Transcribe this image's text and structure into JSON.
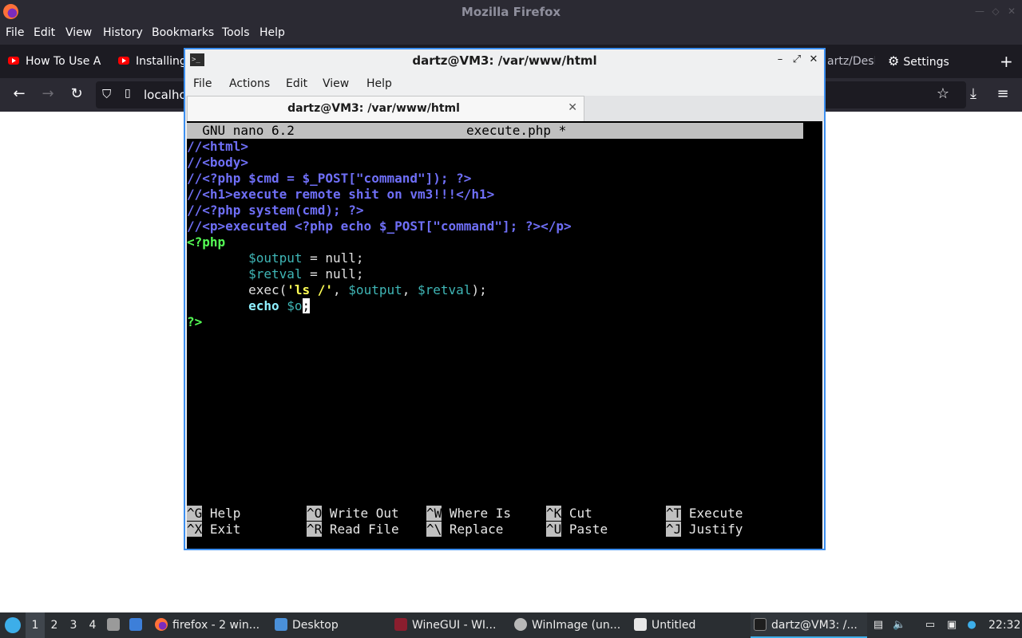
{
  "firefox": {
    "window_title": "Mozilla Firefox",
    "menu": [
      "File",
      "Edit",
      "View",
      "History",
      "Bookmarks",
      "Tools",
      "Help"
    ],
    "tabs": [
      {
        "label": "How To Use A",
        "icon": "youtube-icon"
      },
      {
        "label": "Installing",
        "icon": "youtube-icon"
      },
      {
        "label": "artz/Desk",
        "icon": ""
      },
      {
        "label": "Settings",
        "icon": "gear-icon"
      }
    ],
    "url": "localho",
    "colors": {
      "chrome": "#2b2a33",
      "tabbar": "#1c1b22"
    }
  },
  "terminal": {
    "window_title": "dartz@VM3: /var/www/html",
    "tab_title": "dartz@VM3: /var/www/html",
    "menu": [
      "File",
      "Actions",
      "Edit",
      "View",
      "Help"
    ],
    "accent": "#3c8ff0"
  },
  "nano": {
    "header_left": "  GNU nano 6.2",
    "header_file": "execute.php *",
    "lines": [
      {
        "parts": [
          {
            "t": "//<html>",
            "c": "cm"
          }
        ]
      },
      {
        "parts": [
          {
            "t": "//<body>",
            "c": "cm"
          }
        ]
      },
      {
        "parts": [
          {
            "t": "//<?php $cmd = $_POST[\"command\"]); ?>",
            "c": "cm"
          }
        ]
      },
      {
        "parts": [
          {
            "t": "//<h1>execute remote shit on vm3!!!</h1>",
            "c": "cm"
          }
        ]
      },
      {
        "parts": [
          {
            "t": "//<?php system(cmd); ?>",
            "c": "cm"
          }
        ]
      },
      {
        "parts": [
          {
            "t": "//<p>executed <?php echo $_POST[\"command\"]; ?></p>",
            "c": "cm"
          }
        ]
      },
      {
        "parts": [
          {
            "t": "<?php",
            "c": "kw"
          }
        ]
      },
      {
        "parts": [
          {
            "t": "        ",
            "c": "pl"
          },
          {
            "t": "$output",
            "c": "var"
          },
          {
            "t": " = null;",
            "c": "pl"
          }
        ]
      },
      {
        "parts": [
          {
            "t": "        ",
            "c": "pl"
          },
          {
            "t": "$retval",
            "c": "var"
          },
          {
            "t": " = null;",
            "c": "pl"
          }
        ]
      },
      {
        "parts": [
          {
            "t": "        exec(",
            "c": "pl"
          },
          {
            "t": "'ls /'",
            "c": "str"
          },
          {
            "t": ", ",
            "c": "pl"
          },
          {
            "t": "$output",
            "c": "var"
          },
          {
            "t": ", ",
            "c": "pl"
          },
          {
            "t": "$retval",
            "c": "var"
          },
          {
            "t": ");",
            "c": "pl"
          }
        ]
      },
      {
        "parts": [
          {
            "t": "        ",
            "c": "pl"
          },
          {
            "t": "echo",
            "c": "ec"
          },
          {
            "t": " ",
            "c": "pl"
          },
          {
            "t": "$o",
            "c": "var"
          },
          {
            "t": ";",
            "c": "cursor"
          }
        ]
      },
      {
        "parts": [
          {
            "t": "?>",
            "c": "kw"
          }
        ]
      }
    ],
    "shortcuts": [
      [
        {
          "key": "^G",
          "label": "Help"
        },
        {
          "key": "^O",
          "label": "Write Out"
        },
        {
          "key": "^W",
          "label": "Where Is"
        },
        {
          "key": "^K",
          "label": "Cut"
        },
        {
          "key": "^T",
          "label": "Execute"
        }
      ],
      [
        {
          "key": "^X",
          "label": "Exit"
        },
        {
          "key": "^R",
          "label": "Read File"
        },
        {
          "key": "^\\",
          "label": "Replace"
        },
        {
          "key": "^U",
          "label": "Paste"
        },
        {
          "key": "^J",
          "label": "Justify"
        }
      ]
    ]
  },
  "taskbar": {
    "workspaces": [
      "1",
      "2",
      "3",
      "4"
    ],
    "tasks": [
      {
        "label": "firefox - 2 win...",
        "icon": "firefox-icon"
      },
      {
        "label": "Desktop",
        "icon": "folder-icon"
      },
      {
        "label": "WineGUI - WI...",
        "icon": "wine-icon"
      },
      {
        "label": "WinImage (un...",
        "icon": "winimage-icon"
      },
      {
        "label": "Untitled",
        "icon": "text-editor-icon"
      },
      {
        "label": "dartz@VM3: /...",
        "icon": "terminal-icon"
      }
    ],
    "clock": "22:32"
  }
}
